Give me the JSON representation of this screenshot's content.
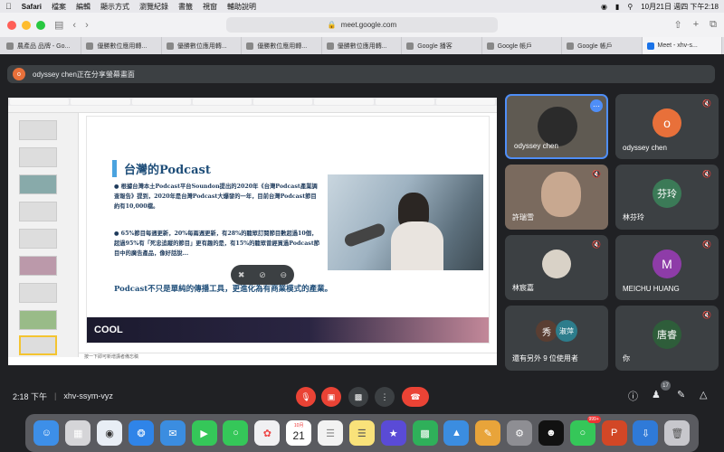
{
  "menubar": {
    "items": [
      "Safari",
      "檔案",
      "編輯",
      "顯示方式",
      "瀏覽紀錄",
      "書籤",
      "視窗",
      "輔助說明"
    ],
    "clock": "10月21日 週四 下午2:18"
  },
  "browser": {
    "url": "meet.google.com",
    "tabs": [
      {
        "label": "農產品 品牌 - Go..."
      },
      {
        "label": "優勝數位應用轉..."
      },
      {
        "label": "優勝數位應用轉..."
      },
      {
        "label": "優勝數位應用轉..."
      },
      {
        "label": "優勝數位應用轉..."
      },
      {
        "label": "Google 播客"
      },
      {
        "label": "Google 帳戶"
      },
      {
        "label": "Google 帳戶"
      },
      {
        "label": "Meet - xhv-s..."
      }
    ]
  },
  "meet": {
    "presenting_initial": "o",
    "presenting_text": "odyssey chen正在分享螢幕畫面",
    "time": "2:18 下午",
    "meeting_code": "xhv-ssym-vyz",
    "people_count": "17"
  },
  "slide": {
    "title": "台灣的Podcast",
    "bullet1": "● 根據台灣本土Podcast平台Soundon提出的2020年《台灣Podcast產業調查報告》提到，2020年是台灣Podcast大爆發的一年，目前台灣Podcast節目約有10,000檔。",
    "bullet2": "● 65%節目每週更新，20%每兩週更新，有28%的聽眾訂閱節目數超過10個，超過95%有「死忠追蹤的節目」更有趣的是，有15%的聽眾曾經買過Podcast節目中的廣告產品，像好話說...",
    "footer": "Podcast不只是單純的傳播工具，更進化為有商業模式的產業。",
    "logo": "COOL",
    "notes": "按一下即可新增講者備忘稿"
  },
  "participants": [
    {
      "name": "odyssey chen",
      "type": "video"
    },
    {
      "name": "odyssey chen",
      "initial": "o",
      "color": "#e8703a"
    },
    {
      "name": "許瑞雪",
      "type": "video"
    },
    {
      "name": "林芬玲",
      "initial": "芬玲",
      "color": "#3b7a57"
    },
    {
      "name": "林宸嘉",
      "initial": "",
      "color": "#9aa0a6"
    },
    {
      "name": "MEICHU HUANG",
      "initial": "M",
      "color": "#8e3ca8"
    },
    {
      "name": "還有另外 9 位使用者",
      "initial1": "秀",
      "initial2": "淑萍",
      "color1": "#5a3e32",
      "color2": "#2d7d8c"
    },
    {
      "name": "你",
      "initial": "唐睿",
      "color": "#2e5d3a"
    }
  ],
  "dock": {
    "calendar_month": "10月",
    "calendar_day": "21",
    "badge": "999+"
  }
}
